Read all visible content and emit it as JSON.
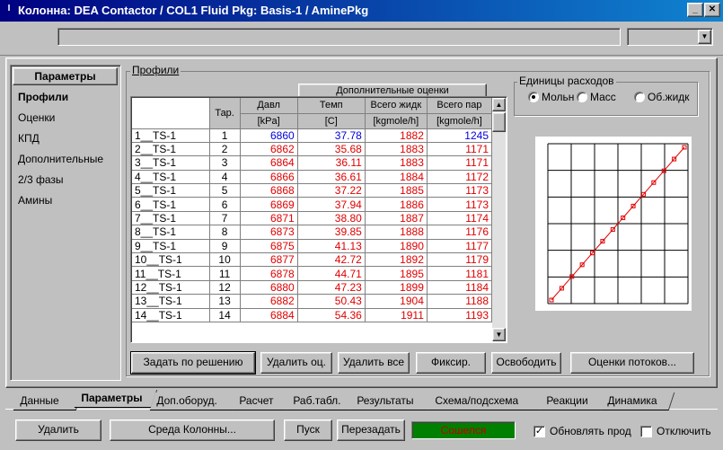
{
  "window": {
    "title": "Колонна: DEA Contactor / COL1  Fluid Pkg: Basis-1 / AminePkg",
    "sys_icon": "I"
  },
  "nav": {
    "header": "Параметры",
    "items": [
      "Профили",
      "Оценки",
      "КПД",
      "Дополнительные",
      "2/3 фазы",
      "Амины"
    ]
  },
  "profiles": {
    "group_label": "Профили",
    "extra_header": "Дополнительные оценки",
    "columns": [
      {
        "name": "Тар.",
        "unit": ""
      },
      {
        "name": "Давл",
        "unit": "[kPa]"
      },
      {
        "name": "Темп",
        "unit": "[C]"
      },
      {
        "name": "Всего жидк",
        "unit": "[kgmole/h]"
      },
      {
        "name": "Всего пар",
        "unit": "[kgmole/h]"
      }
    ],
    "rows": [
      {
        "label": "1__TS-1",
        "tray": "1",
        "p": "6860",
        "t": "37.78",
        "liq": "1882",
        "vap": "1245"
      },
      {
        "label": "2__TS-1",
        "tray": "2",
        "p": "6862",
        "t": "35.68",
        "liq": "1883",
        "vap": "1171"
      },
      {
        "label": "3__TS-1",
        "tray": "3",
        "p": "6864",
        "t": "36.11",
        "liq": "1883",
        "vap": "1171"
      },
      {
        "label": "4__TS-1",
        "tray": "4",
        "p": "6866",
        "t": "36.61",
        "liq": "1884",
        "vap": "1172"
      },
      {
        "label": "5__TS-1",
        "tray": "5",
        "p": "6868",
        "t": "37.22",
        "liq": "1885",
        "vap": "1173"
      },
      {
        "label": "6__TS-1",
        "tray": "6",
        "p": "6869",
        "t": "37.94",
        "liq": "1886",
        "vap": "1173"
      },
      {
        "label": "7__TS-1",
        "tray": "7",
        "p": "6871",
        "t": "38.80",
        "liq": "1887",
        "vap": "1174"
      },
      {
        "label": "8__TS-1",
        "tray": "8",
        "p": "6873",
        "t": "39.85",
        "liq": "1888",
        "vap": "1176"
      },
      {
        "label": "9__TS-1",
        "tray": "9",
        "p": "6875",
        "t": "41.13",
        "liq": "1890",
        "vap": "1177"
      },
      {
        "label": "10__TS-1",
        "tray": "10",
        "p": "6877",
        "t": "42.72",
        "liq": "1892",
        "vap": "1179"
      },
      {
        "label": "11__TS-1",
        "tray": "11",
        "p": "6878",
        "t": "44.71",
        "liq": "1895",
        "vap": "1181"
      },
      {
        "label": "12__TS-1",
        "tray": "12",
        "p": "6880",
        "t": "47.23",
        "liq": "1899",
        "vap": "1184"
      },
      {
        "label": "13__TS-1",
        "tray": "13",
        "p": "6882",
        "t": "50.43",
        "liq": "1904",
        "vap": "1188"
      },
      {
        "label": "14__TS-1",
        "tray": "14",
        "p": "6884",
        "t": "54.36",
        "liq": "1911",
        "vap": "1193"
      }
    ],
    "blue_cells": [
      "p0",
      "t0",
      "vap0"
    ]
  },
  "flow_units": {
    "label": "Единицы расходов",
    "options": [
      "Мольн",
      "Масс",
      "Об.жидк"
    ],
    "selected": "Мольн"
  },
  "buttons": {
    "set_by_solution": "Задать по решению",
    "delete_est": "Удалить оц.",
    "delete_all": "Удалить все",
    "fix": "Фиксир.",
    "release": "Освободить",
    "stream_est": "Оценки потоков..."
  },
  "tabs": [
    "Данные",
    "Параметры",
    "Доп.оборуд.",
    "Расчет",
    "Раб.табл.",
    "Результаты",
    "Схема/подсхема",
    "Реакции",
    "Динамика"
  ],
  "active_tab": "Параметры",
  "bottom": {
    "delete": "Удалить",
    "column_env": "Среда Колонны...",
    "run": "Пуск",
    "reset": "Перезадать",
    "status": "Сошелся",
    "update_outlets": "Обновлять прод",
    "disable": "Отключить"
  },
  "colors": {
    "status_bg": "#008000",
    "red": "#e00000",
    "blue": "#0000e0"
  }
}
